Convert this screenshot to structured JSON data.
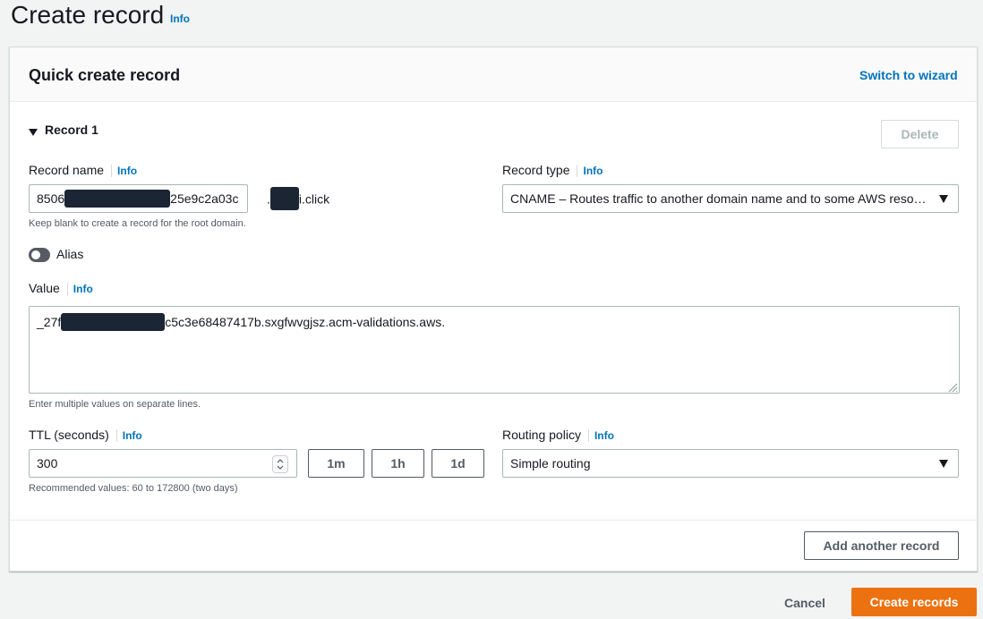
{
  "page": {
    "title": "Create record",
    "info": "Info"
  },
  "card": {
    "title": "Quick create record",
    "switch_label": "Switch to wizard"
  },
  "record": {
    "section_label": "Record 1",
    "delete_label": "Delete",
    "name": {
      "label": "Record name",
      "info": "Info",
      "value_start": "8506",
      "value_end": "25e9c2a03c",
      "domain_prefix": ".",
      "domain_suffix": "i.click",
      "hint": "Keep blank to create a record for the root domain."
    },
    "type": {
      "label": "Record type",
      "info": "Info",
      "selected": "CNAME – Routes traffic to another domain name and to some AWS reso…"
    },
    "alias": {
      "label": "Alias",
      "enabled": false
    },
    "value": {
      "label": "Value",
      "info": "Info",
      "text_start": "_27f",
      "text_end": "c5c3e68487417b.sxgfwvgjsz.acm-validations.aws.",
      "hint": "Enter multiple values on separate lines."
    },
    "ttl": {
      "label": "TTL (seconds)",
      "info": "Info",
      "value": "300",
      "presets": [
        "1m",
        "1h",
        "1d"
      ],
      "hint": "Recommended values: 60 to 172800 (two days)"
    },
    "routing": {
      "label": "Routing policy",
      "info": "Info",
      "selected": "Simple routing"
    }
  },
  "add_record_label": "Add another record",
  "footer": {
    "cancel_label": "Cancel",
    "create_label": "Create records"
  },
  "colors": {
    "accent": "#0073bb",
    "primary": "#ec7211",
    "redaction": "#1b2533"
  }
}
